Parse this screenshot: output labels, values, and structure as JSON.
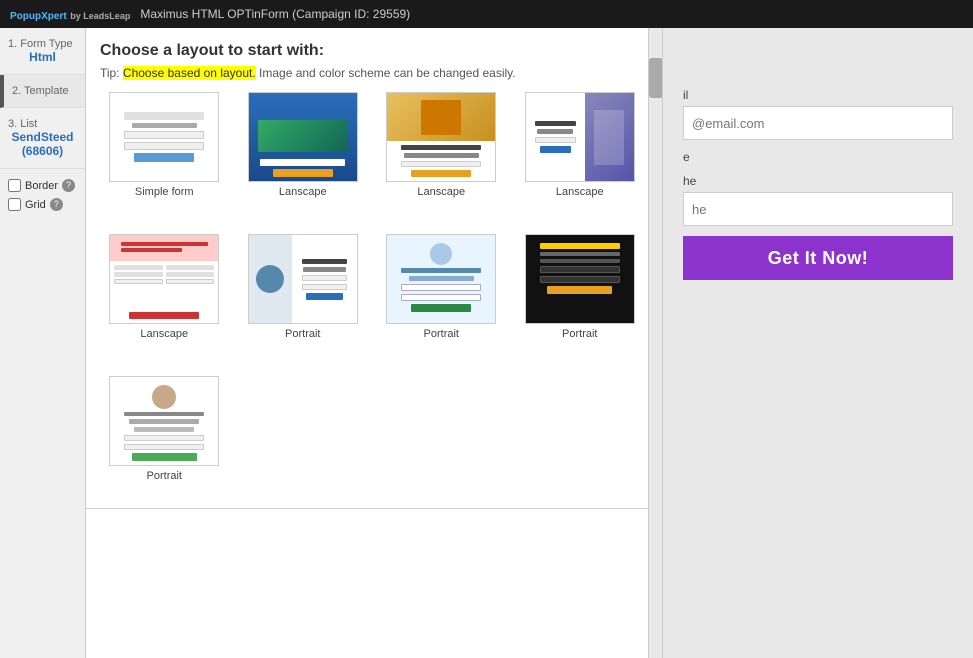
{
  "topbar": {
    "brand": "PopupXpert",
    "brand_sub": "by LeadsLeap",
    "campaign_title": "Maximus HTML OPTinForm (Campaign ID: 29559)"
  },
  "sidebar": {
    "steps": [
      {
        "step": "1.",
        "label": "Form Type",
        "value": "Html"
      },
      {
        "step": "2.",
        "label": "Template",
        "value": ""
      },
      {
        "step": "3.",
        "label": "List",
        "value": "SendSteed\n(68606)"
      }
    ],
    "border_label": "Border",
    "grid_label": "Grid"
  },
  "chooser": {
    "title": "Choose a layout to start with:",
    "tip_prefix": "Tip:",
    "tip_highlight": "Choose based on layout.",
    "tip_suffix": " Image and color scheme can be changed easily.",
    "layouts": [
      {
        "id": "simple-form",
        "label": "Simple form",
        "type": "simple"
      },
      {
        "id": "lanscape-1",
        "label": "Lanscape",
        "type": "blue"
      },
      {
        "id": "lanscape-2",
        "label": "Lanscape",
        "type": "landscape2"
      },
      {
        "id": "lanscape-3",
        "label": "Lanscape",
        "type": "landscape3"
      },
      {
        "id": "lanscape-4",
        "label": "Lanscape",
        "type": "landscape4"
      },
      {
        "id": "portrait-1",
        "label": "Portrait",
        "type": "portrait1"
      },
      {
        "id": "portrait-2",
        "label": "Portrait",
        "type": "portrait2"
      },
      {
        "id": "portrait-3",
        "label": "Portrait",
        "type": "portrait3"
      },
      {
        "id": "portrait-4",
        "label": "Portrait",
        "type": "portrait4"
      }
    ]
  },
  "form_preview": {
    "email_label": "il",
    "email_placeholder": "@email.com",
    "field2_label": "e",
    "field3_label": "he",
    "field3_placeholder": "he",
    "button_label": "Get It Now!"
  }
}
